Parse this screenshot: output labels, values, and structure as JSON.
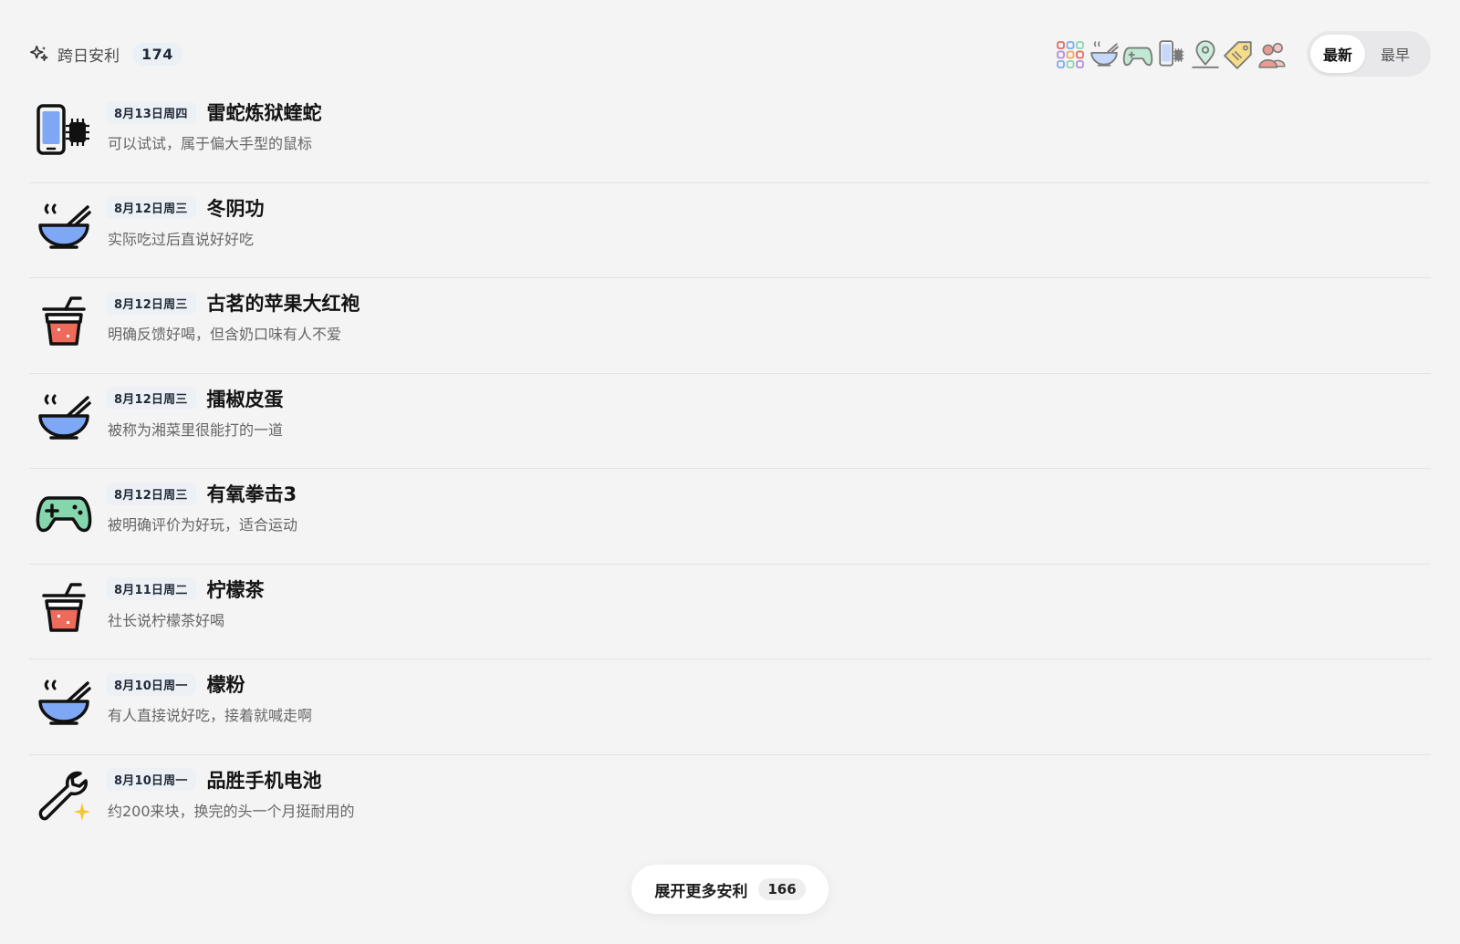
{
  "header": {
    "title": "跨日安利",
    "count": "174",
    "filters": [
      {
        "name": "all-categories-icon"
      },
      {
        "name": "food-icon"
      },
      {
        "name": "game-icon"
      },
      {
        "name": "gadget-icon"
      },
      {
        "name": "location-icon"
      },
      {
        "name": "deals-icon"
      },
      {
        "name": "people-icon"
      }
    ],
    "sort": {
      "active_label": "最新",
      "inactive_label": "最早"
    }
  },
  "items": [
    {
      "icon": "gadget-icon",
      "date": "8月13日周四",
      "title": "雷蛇炼狱蝰蛇",
      "desc": "可以试试，属于偏大手型的鼠标"
    },
    {
      "icon": "food-icon",
      "date": "8月12日周三",
      "title": "冬阴功",
      "desc": "实际吃过后直说好好吃"
    },
    {
      "icon": "drink-icon",
      "date": "8月12日周三",
      "title": "古茗的苹果大红袍",
      "desc": "明确反馈好喝，但含奶口味有人不爱"
    },
    {
      "icon": "food-icon",
      "date": "8月12日周三",
      "title": "擂椒皮蛋",
      "desc": "被称为湘菜里很能打的一道"
    },
    {
      "icon": "game-icon",
      "date": "8月12日周三",
      "title": "有氧拳击3",
      "desc": "被明确评价为好玩，适合运动"
    },
    {
      "icon": "drink-icon",
      "date": "8月11日周二",
      "title": "柠檬茶",
      "desc": "社长说柠檬茶好喝"
    },
    {
      "icon": "food-icon",
      "date": "8月10日周一",
      "title": "檬粉",
      "desc": "有人直接说好吃，接着就喊走啊"
    },
    {
      "icon": "tool-icon",
      "date": "8月10日周一",
      "title": "品胜手机电池",
      "desc": "约200来块，换完的头一个月挺耐用的"
    }
  ],
  "load_more": {
    "label": "展开更多安利",
    "count": "166"
  },
  "colors": {
    "background": "#f4f4f4",
    "chip": "#edf1f6",
    "food_blue": "#7ea8f5",
    "drink_red": "#ee6a5a",
    "game_green": "#86d6ad",
    "sparkle_yellow": "#f7c531"
  }
}
